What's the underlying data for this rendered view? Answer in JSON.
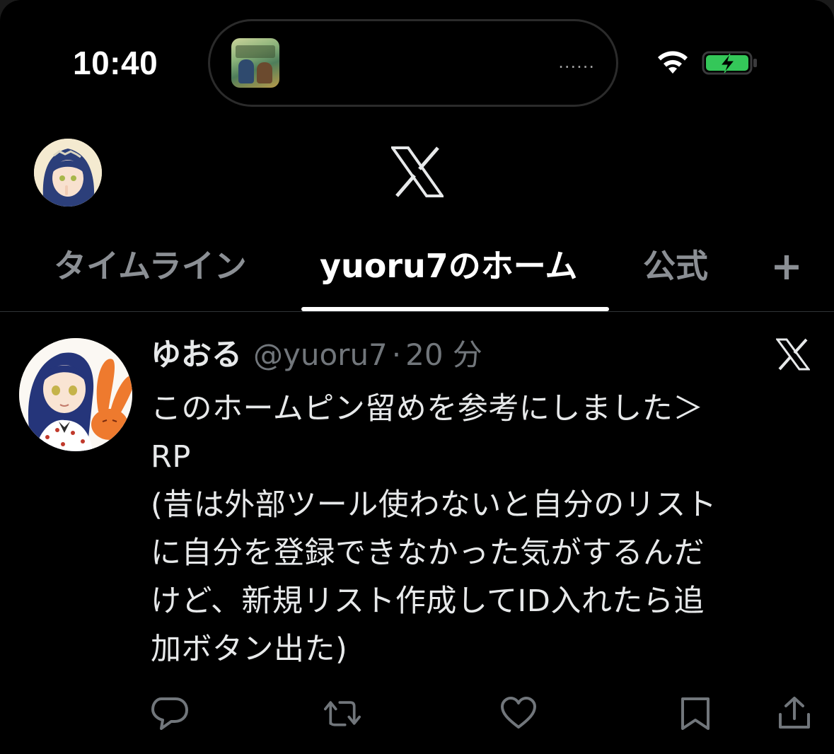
{
  "status_bar": {
    "time": "10:40",
    "island_dots": "......",
    "battery_state": "charging",
    "battery_color": "#34c759"
  },
  "header": {
    "logo": "x-logo",
    "avatar": "user-avatar"
  },
  "tabs": [
    {
      "label": "タイムライン",
      "active": false
    },
    {
      "label": "yuoru7のホーム",
      "active": true
    },
    {
      "label": "公式",
      "active": false
    }
  ],
  "add_tab": {
    "label": "+"
  },
  "tweet": {
    "author_name": "ゆおる",
    "handle": "@yuoru7",
    "separator": "·",
    "time_ago": "20 分",
    "text": "このホームピン留めを参考にしました＞\nRP\n(昔は外部ツール使わないと自分のリスト\nに自分を登録できなかった気がするんだ\nけど、新規リスト作成してID入れたら追\n加ボタン出た)",
    "source_icon": "x-icon",
    "actions": [
      "reply-icon",
      "retweet-icon",
      "like-icon",
      "bookmark-icon",
      "share-icon"
    ]
  },
  "colors": {
    "background": "#000000",
    "text_primary": "#e7e9ea",
    "text_secondary": "#71767b",
    "tab_inactive": "#8b8f94",
    "divider": "#2f3336"
  }
}
